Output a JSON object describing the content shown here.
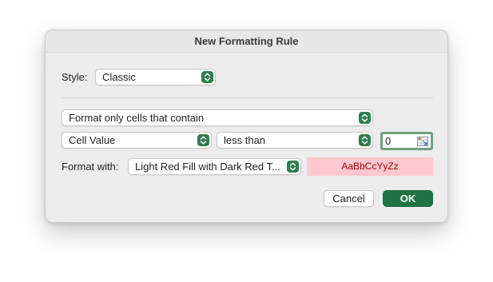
{
  "dialog": {
    "title": "New Formatting Rule"
  },
  "style_row": {
    "label": "Style:",
    "value": "Classic"
  },
  "rule": {
    "type_value": "Format only cells that contain",
    "condition_subject": "Cell Value",
    "condition_operator": "less than",
    "condition_value": "0"
  },
  "format_row": {
    "label": "Format with:",
    "value": "Light Red Fill with Dark Red T...",
    "preview_text": "AaBbCcYyZz"
  },
  "buttons": {
    "cancel": "Cancel",
    "ok": "OK"
  },
  "colors": {
    "accent": "#217346",
    "preview_fill": "#ffc7ce",
    "preview_text": "#9c0006"
  }
}
